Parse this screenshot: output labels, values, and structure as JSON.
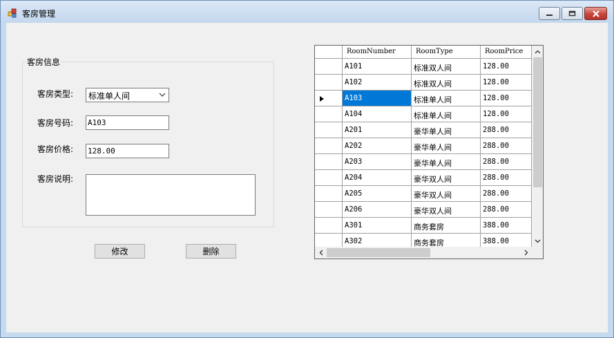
{
  "window": {
    "title": "客房管理"
  },
  "group": {
    "title": "客房信息"
  },
  "form": {
    "type_label": "客房类型:",
    "type_value": "标准单人间",
    "number_label": "客房号码:",
    "number_value": "A103",
    "price_label": "客房价格:",
    "price_value": "128.00",
    "desc_label": "客房说明:",
    "desc_value": ""
  },
  "buttons": {
    "modify": "修改",
    "delete": "删除"
  },
  "grid": {
    "columns": [
      "RoomNumber",
      "RoomType",
      "RoomPrice"
    ],
    "selected_row": 2,
    "rows": [
      [
        "A101",
        "标准双人间",
        "128.00"
      ],
      [
        "A102",
        "标准双人间",
        "128.00"
      ],
      [
        "A103",
        "标准单人间",
        "128.00"
      ],
      [
        "A104",
        "标准单人间",
        "128.00"
      ],
      [
        "A201",
        "豪华单人间",
        "288.00"
      ],
      [
        "A202",
        "豪华单人间",
        "288.00"
      ],
      [
        "A203",
        "豪华单人间",
        "288.00"
      ],
      [
        "A204",
        "豪华双人间",
        "288.00"
      ],
      [
        "A205",
        "豪华双人间",
        "288.00"
      ],
      [
        "A206",
        "豪华双人间",
        "288.00"
      ],
      [
        "A301",
        "商务套房",
        "388.00"
      ],
      [
        "A302",
        "商务套房",
        "388.00"
      ]
    ]
  },
  "icons": {
    "app": "app-window-icon",
    "minimize": "minimize-icon",
    "maximize": "restore-icon",
    "close": "close-icon",
    "combo_arrow": "chevron-down-icon",
    "row_indicator": "row-pointer-icon"
  },
  "colors": {
    "selection": "#0078d7",
    "close_button": "#c8453a"
  }
}
